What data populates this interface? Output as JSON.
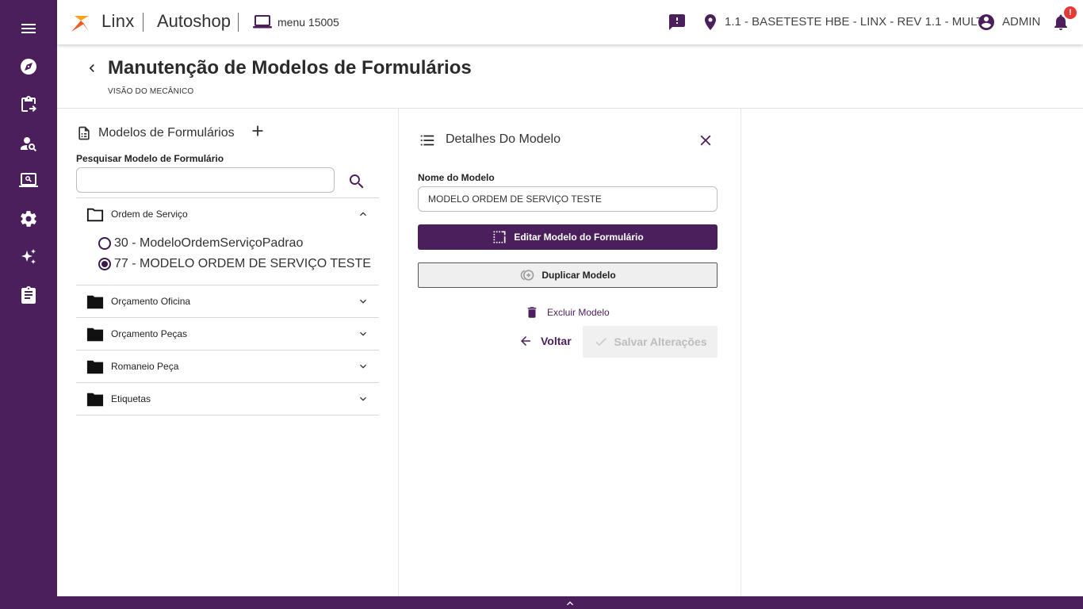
{
  "colors": {
    "brand_purple": "#4a1f5c",
    "accent_orange": "#f05a28",
    "badge_red": "#e53935"
  },
  "sidebar": {
    "items": [
      {
        "icon": "menu-icon"
      },
      {
        "icon": "compass-icon"
      },
      {
        "icon": "clipboard-arrow-icon"
      },
      {
        "icon": "person-search-icon"
      },
      {
        "icon": "screen-search-icon"
      },
      {
        "icon": "gear-icon"
      },
      {
        "icon": "sparkles-icon"
      },
      {
        "icon": "clipboard-icon"
      }
    ]
  },
  "header": {
    "brand": "Linx",
    "product": "Autoshop",
    "menu_code": "menu 15005",
    "store": "1.1 - BASETESTE HBE - LINX - REV 1.1 - MULT",
    "user": "ADMIN",
    "notification_badge": "!"
  },
  "page": {
    "title": "Manutenção de Modelos de Formulários",
    "subtitle": "VISÃO DO MECÂNICO"
  },
  "left_panel": {
    "title": "Modelos de Formulários",
    "search_label": "Pesquisar Modelo de Formulário",
    "search_value": "",
    "folders": [
      {
        "label": "Ordem de Serviço",
        "expanded": true,
        "items": [
          {
            "label": "30 - ModeloOrdemServiçoPadrao",
            "selected": false
          },
          {
            "label": "77 - MODELO ORDEM DE SERVIÇO TESTE",
            "selected": true
          }
        ]
      },
      {
        "label": "Orçamento Oficina",
        "expanded": false
      },
      {
        "label": "Orçamento Peças",
        "expanded": false
      },
      {
        "label": "Romaneio Peça",
        "expanded": false
      },
      {
        "label": "Etiquetas",
        "expanded": false
      }
    ]
  },
  "detail_panel": {
    "title": "Detalhes Do Modelo",
    "name_label": "Nome do Modelo",
    "name_value": "MODELO ORDEM DE SERVIÇO TESTE",
    "edit_button": "Editar Modelo do Formulário",
    "duplicate_button": "Duplicar Modelo",
    "delete_button": "Excluir Modelo",
    "back_button": "Voltar",
    "save_button": "Salvar Alterações"
  }
}
